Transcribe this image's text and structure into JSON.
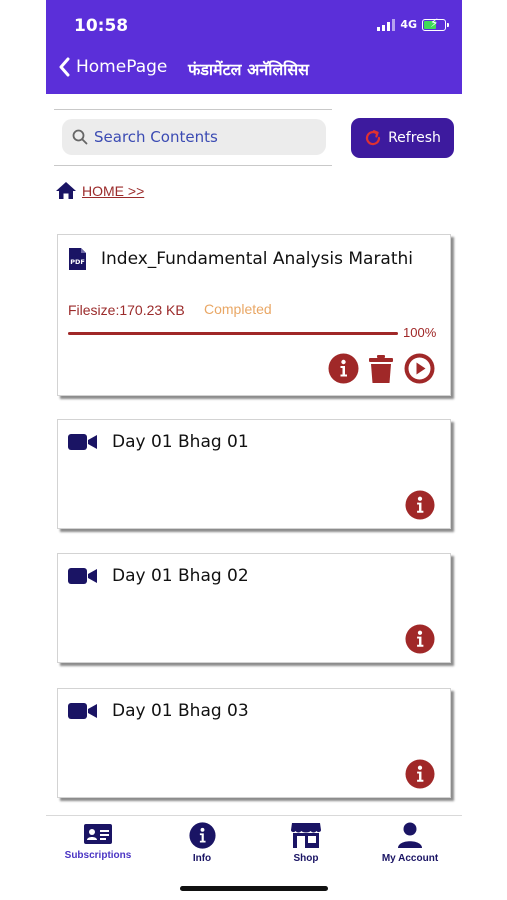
{
  "status_bar": {
    "time": "10:58",
    "network": "4G"
  },
  "header": {
    "back_label": "HomePage",
    "title": "फंडामेंटल अनॅलिसिस"
  },
  "search": {
    "placeholder": "Search Contents",
    "value": ""
  },
  "refresh": {
    "label": "Refresh"
  },
  "breadcrumb": {
    "home_label": "HOME >>"
  },
  "items": [
    {
      "title": "Index_Fundamental Analysis Marathi",
      "type_icon": "pdf-icon",
      "filesize": "Filesize:170.23 KB",
      "status": "Completed",
      "progress_label": "100%",
      "progress_value": 1.0
    },
    {
      "title": "Day 01 Bhag 01",
      "type_icon": "video-camera-icon"
    },
    {
      "title": "Day 01 Bhag 02",
      "type_icon": "video-camera-icon"
    },
    {
      "title": "Day 01 Bhag 03",
      "type_icon": "video-camera-icon"
    }
  ],
  "bottom_nav": [
    {
      "label": "Subscriptions",
      "icon": "id-card-icon",
      "active": true
    },
    {
      "label": "Info",
      "icon": "info-icon",
      "active": false
    },
    {
      "label": "Shop",
      "icon": "store-icon",
      "active": false
    },
    {
      "label": "My Account",
      "icon": "user-icon",
      "active": false
    }
  ],
  "colors": {
    "header_bg": "#5b2fd9",
    "refresh_bg": "#3d1a9e",
    "accent_red": "#a02828",
    "status_completed": "#e9a765",
    "icon_navy": "#1a1464",
    "active_nav": "#4a34c4"
  }
}
